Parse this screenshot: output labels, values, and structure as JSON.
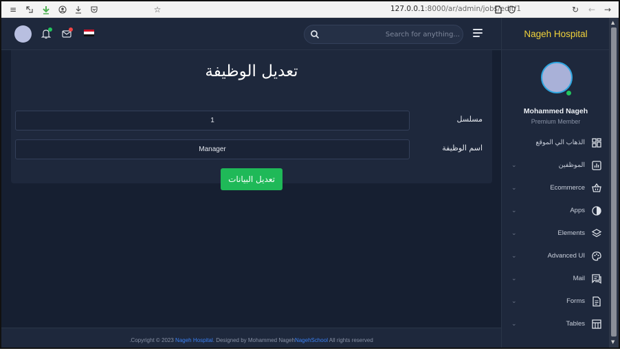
{
  "browser": {
    "url_host": "127.0.0.1",
    "url_path": ":8000/ar/admin/jobs/edit/1"
  },
  "topbar": {
    "search_placeholder": "...Search for anything",
    "notification_dot_color": "#22c55e",
    "message_dot_color": "#ef4444"
  },
  "sidebar": {
    "brand": "Nageh Hospital",
    "profile_name": "Mohammed Nageh",
    "profile_role": "Premium Member",
    "items": [
      {
        "label": "الذهاب الي الموقع",
        "icon": "grid-icon",
        "has_chevron": false
      },
      {
        "label": "الموظفين",
        "icon": "bar-chart-icon",
        "has_chevron": true
      },
      {
        "label": "Ecommerce",
        "icon": "basket-icon",
        "has_chevron": true
      },
      {
        "label": "Apps",
        "icon": "half-circle-icon",
        "has_chevron": true
      },
      {
        "label": "Elements",
        "icon": "layers-icon",
        "has_chevron": true
      },
      {
        "label": "Advanced UI",
        "icon": "palette-icon",
        "has_chevron": true
      },
      {
        "label": "Mail",
        "icon": "chat-icon",
        "has_chevron": true
      },
      {
        "label": "Forms",
        "icon": "document-icon",
        "has_chevron": true
      },
      {
        "label": "Tables",
        "icon": "table-icon",
        "has_chevron": true
      }
    ]
  },
  "card": {
    "title": "تعديل الوظيفة",
    "serial_label": "مسلسل",
    "serial_value": "1",
    "job_name_label": "اسم الوظيفة",
    "job_name_value": "Manager",
    "submit_label": "تعديل البيانات"
  },
  "footer": {
    "prefix": ".Copyright © 2023",
    "brand_link": "Nageh Hospital",
    "middle": ". Designed by Mohammed Nageh",
    "school_link": "NagehSchool",
    "suffix": " All rights reserved"
  },
  "colors": {
    "brand": "#f2d33a",
    "accent_green": "#1fb958",
    "link_blue": "#3b82f6",
    "background": "#161f31",
    "panel": "#1e283c"
  }
}
